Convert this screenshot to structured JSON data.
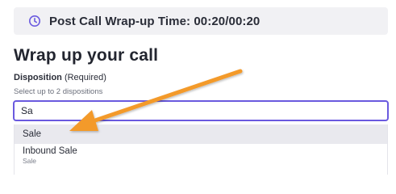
{
  "banner": {
    "icon": "clock-icon",
    "text": "Post Call Wrap-up Time: 00:20/00:20"
  },
  "title": "Wrap up your call",
  "disposition": {
    "label": "Disposition",
    "required": "(Required)",
    "helper": "Select up to 2 dispositions",
    "input_value": "Sa",
    "options": [
      {
        "label": "Sale"
      },
      {
        "label": "Inbound Sale",
        "sublabel": "Sale"
      }
    ]
  },
  "annotation": {
    "icon": "arrow-annotation",
    "color": "#f39a2b"
  }
}
